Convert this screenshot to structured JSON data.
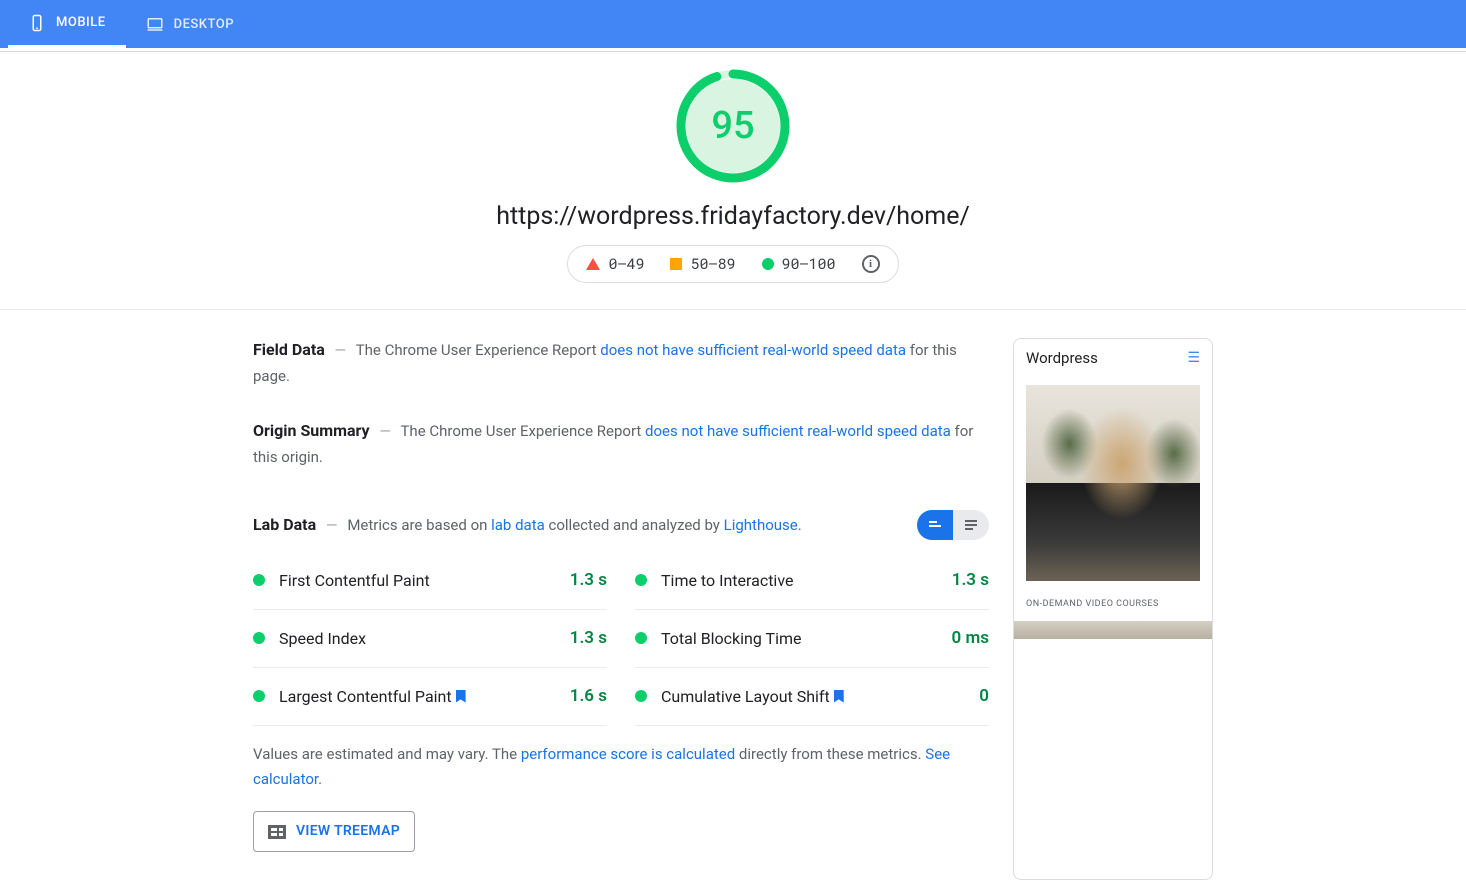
{
  "tabs": {
    "mobile": "MOBILE",
    "desktop": "DESKTOP"
  },
  "score": "95",
  "url": "https://wordpress.fridayfactory.dev/home/",
  "legend": {
    "low": "0–49",
    "mid": "50–89",
    "high": "90–100"
  },
  "fieldData": {
    "title": "Field Data",
    "prefix": "The Chrome User Experience Report ",
    "link": "does not have sufficient real-world speed data",
    "suffix": " for this page."
  },
  "originSummary": {
    "title": "Origin Summary",
    "prefix": "The Chrome User Experience Report ",
    "link": "does not have sufficient real-world speed data",
    "suffix": " for this origin."
  },
  "labData": {
    "title": "Lab Data",
    "prefix": "Metrics are based on ",
    "link1": "lab data",
    "mid": " collected and analyzed by ",
    "link2": "Lighthouse",
    "suffix": "."
  },
  "metrics": [
    {
      "name": "First Contentful Paint",
      "value": "1.3 s",
      "bookmark": false
    },
    {
      "name": "Time to Interactive",
      "value": "1.3 s",
      "bookmark": false
    },
    {
      "name": "Speed Index",
      "value": "1.3 s",
      "bookmark": false
    },
    {
      "name": "Total Blocking Time",
      "value": "0 ms",
      "bookmark": false
    },
    {
      "name": "Largest Contentful Paint",
      "value": "1.6 s",
      "bookmark": true
    },
    {
      "name": "Cumulative Layout Shift",
      "value": "0",
      "bookmark": true
    }
  ],
  "note": {
    "prefix": "Values are estimated and may vary. The ",
    "link1": "performance score is calculated",
    "mid": " directly from these metrics. ",
    "link2": "See calculator."
  },
  "treemap": "VIEW TREEMAP",
  "preview": {
    "title": "Wordpress",
    "caption": "ON-DEMAND VIDEO COURSES"
  }
}
